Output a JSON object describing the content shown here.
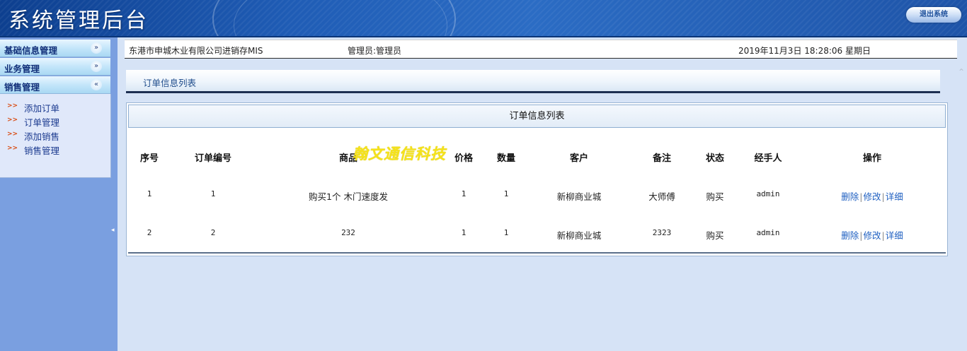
{
  "header": {
    "title": "系统管理后台",
    "logout_label": "退出系统"
  },
  "sidebar": {
    "menus": [
      {
        "label": "基础信息管理",
        "icon": "chevron-double-down-icon"
      },
      {
        "label": "业务管理",
        "icon": "chevron-double-down-icon"
      },
      {
        "label": "销售管理",
        "icon": "chevron-double-up-icon"
      }
    ],
    "sub_items": [
      {
        "label": "添加订单"
      },
      {
        "label": "订单管理"
      },
      {
        "label": "添加销售"
      },
      {
        "label": "销售管理"
      }
    ],
    "collapse_glyph": "◂"
  },
  "info_bar": {
    "company": "东港市申城木业有限公司进销存MIS",
    "admin": "管理员:管理员",
    "datetime": "2019年11月3日  18:28:06 星期日"
  },
  "breadcrumb": {
    "label": "订单信息列表"
  },
  "table": {
    "title": "订单信息列表",
    "columns": [
      "序号",
      "订单编号",
      "商品",
      "价格",
      "数量",
      "客户",
      "备注",
      "状态",
      "经手人",
      "操作"
    ],
    "rows": [
      {
        "index": "1",
        "order_no": "1",
        "product": "购买1个 木门速度发",
        "price": "1",
        "qty": "1",
        "customer": "新柳商业城",
        "note": "大师傅",
        "status": "购买",
        "handler": "admin"
      },
      {
        "index": "2",
        "order_no": "2",
        "product": "232",
        "price": "1",
        "qty": "1",
        "customer": "新柳商业城",
        "note": "2323",
        "status": "购买",
        "handler": "admin"
      }
    ],
    "actions": {
      "delete": "删除",
      "edit": "修改",
      "detail": "详细",
      "separator": "|"
    }
  },
  "watermark": "翰文通信科技",
  "colors": {
    "header_bg": "#1f5cb5",
    "sidebar_bg": "#7a9fe0",
    "main_bg": "#d6e3f6",
    "link": "#1e5fc1",
    "watermark": "#f5e21a"
  }
}
